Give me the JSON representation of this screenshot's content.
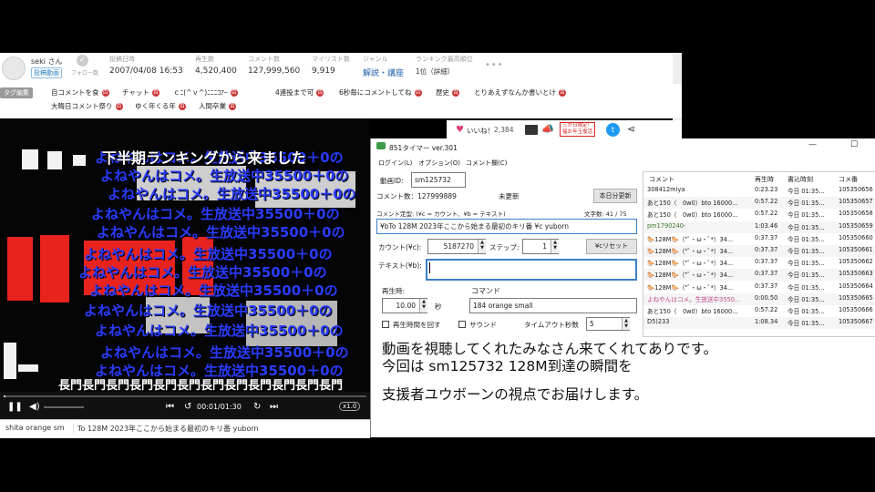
{
  "video_info": {
    "owner_name": "seki さん",
    "owner_badge": "投稿動画",
    "follow_label": "フォロー数",
    "stats": [
      {
        "label": "投稿日時",
        "value": "2007/04/08 16:53"
      },
      {
        "label": "再生数",
        "value": "4,520,400"
      },
      {
        "label": "コメント数",
        "value": "127,999,560"
      },
      {
        "label": "マイリスト数",
        "value": "9,919"
      },
      {
        "label": "ジャンル",
        "value": "解説・講座"
      },
      {
        "label": "ランキング最高順位",
        "value": "1位（詳細）"
      }
    ],
    "more": "•••"
  },
  "tags": {
    "edit_label": "タグ編集",
    "items": [
      "自コメントを食",
      "チャット",
      "ｃﾆ(^ｖ^)ﾆﾆﾆｺｱｰ",
      "4連投まで可",
      "6秒毎にコメントしてね",
      "歴史",
      "とりあえずなんか書いとけ",
      "大晦日コメント祭り",
      "ゆく年くる年",
      "人間卒業"
    ],
    "tag_icon": "dic-icon"
  },
  "video": {
    "comments": [
      "よねやんはコメ。生放送中35500＋0の",
      "下半期ランキングから来ました",
      "長門長門長門長門長門長門長門長門長門長門長門長門"
    ],
    "time": "00:01/01:30",
    "speed": "x1.0",
    "command_value": "shita orange sm",
    "comment_text": "To 128M 2023年ここから始まる最初のキリ番 yuborn"
  },
  "likebar": {
    "like_label": "いいね！",
    "like_count": "2,384",
    "campaign_text": "三が日限定！\n福お年玉復活",
    "icons": [
      "heart-icon",
      "thread-icon",
      "nicoad-icon",
      "twitter-icon",
      "share-icon"
    ]
  },
  "app": {
    "title": "851タイマー ver.301",
    "menus": [
      "ログイン(L)",
      "オプション(O)",
      "コメント欄(C)"
    ],
    "video_id_label": "動画ID:",
    "video_id": "sm125732",
    "comment_count_label": "コメント数：127999889",
    "update_status": "未更新",
    "fetch_button": "本日分更新",
    "definition_label": "コメント定型: (¥c = カウント、¥b = テキスト)",
    "char_count": "文字数: 41 / 75",
    "template_text": "¥bTo 128M 2023年ここから始まる最初のキリ番 ¥c yuborn",
    "count_label": "カウント(¥c):",
    "count_value": "5187270",
    "step_label": "ステップ:",
    "step_value": "1",
    "reset_button": "¥cリセット",
    "text_label": "テキスト(¥b):",
    "text_value": "",
    "replay_time_label": "再生時:",
    "replay_time_value": "10.00",
    "seconds_unit": "秒",
    "command_label": "コマンド",
    "command_value": "184 orange small",
    "loop_label": "再生時間を回す",
    "sound_label": "サウンド",
    "timeout_label": "タイムアウト秒数",
    "timeout_value": "5",
    "table_headers": [
      "コメント",
      "再生時",
      "書込時刻",
      "コメ番"
    ],
    "table_rows": [
      {
        "c": "308412miya",
        "t": "0:23.23",
        "w": "今日 01:35...",
        "n": "105350656",
        "k": ""
      },
      {
        "c": "あと150（　0w0）bto 16000...",
        "t": "0:57.22",
        "w": "今日 01:35...",
        "n": "105350657",
        "k": ""
      },
      {
        "c": "あと150（　0w0）bto 16000...",
        "t": "0:57.22",
        "w": "今日 01:35...",
        "n": "105350658",
        "k": ""
      },
      {
        "c": "pm1790240-",
        "t": "1:03.46",
        "w": "今日 01:35...",
        "n": "105350659",
        "k": "pm"
      },
      {
        "c": "🐎128M🐎（*ﾟ・ω・ﾟ*）34...",
        "t": "0:37.37",
        "w": "今日 01:35...",
        "n": "105350660",
        "k": ""
      },
      {
        "c": "🐎128M🐎（*ﾟ・ω・ﾟ*）34...",
        "t": "0:37.37",
        "w": "今日 01:35...",
        "n": "105350661",
        "k": ""
      },
      {
        "c": "🐎128M🐎（*ﾟ・ω・ﾟ*）34...",
        "t": "0:37.37",
        "w": "今日 01:35...",
        "n": "105350662",
        "k": ""
      },
      {
        "c": "🐎128M🐎（*ﾟ・ω・ﾟ*）34...",
        "t": "0:37.37",
        "w": "今日 01:35...",
        "n": "105350663",
        "k": ""
      },
      {
        "c": "🐎128M🐎（*ﾟ・ω・ﾟ*）34...",
        "t": "0:37.37",
        "w": "今日 01:35...",
        "n": "105350664",
        "k": ""
      },
      {
        "c": "よねやんはコメ。生放送中3550...",
        "t": "0:00.50",
        "w": "今日 01:35...",
        "n": "105350665",
        "k": "sn"
      },
      {
        "c": "あと150（　0w0）bto 16000...",
        "t": "0:57.22",
        "w": "今日 01:35...",
        "n": "105350666",
        "k": ""
      },
      {
        "c": "D5)233",
        "t": "1:08.34",
        "w": "今日 01:35...",
        "n": "105350667",
        "k": ""
      }
    ]
  },
  "caption": {
    "line1": "動画を視聴してくれたみなさん来てくれてありです。",
    "line2": "今回は sm125732 128M到達の瞬間を",
    "line3": "支援者ユウボーンの視点でお届けします。"
  }
}
